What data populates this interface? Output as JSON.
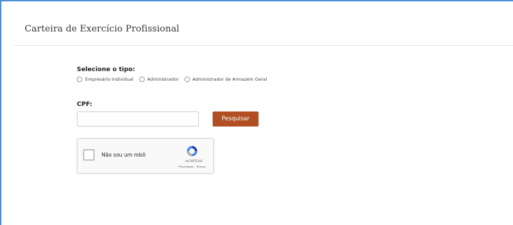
{
  "page": {
    "title": "Carteira de Exercício Profissional"
  },
  "form": {
    "type_label": "Selecione o tipo:",
    "type_options": [
      {
        "label": "Empresário Individual",
        "selected": false
      },
      {
        "label": "Administrador",
        "selected": false
      },
      {
        "label": "Administrador de Armazém Geral",
        "selected": false
      }
    ],
    "cpf_label": "CPF:",
    "cpf_value": "",
    "search_label": "Pesquisar"
  },
  "recaptcha": {
    "checkbox_label": "Não sou um robô",
    "brand": "reCAPTCHA",
    "privacy": "Privacidade",
    "separator": " - ",
    "terms": "Termos",
    "checked": false
  },
  "colors": {
    "frame_border": "#4a8fd6",
    "button_bg": "#b14f23",
    "button_text": "#ffffff"
  }
}
